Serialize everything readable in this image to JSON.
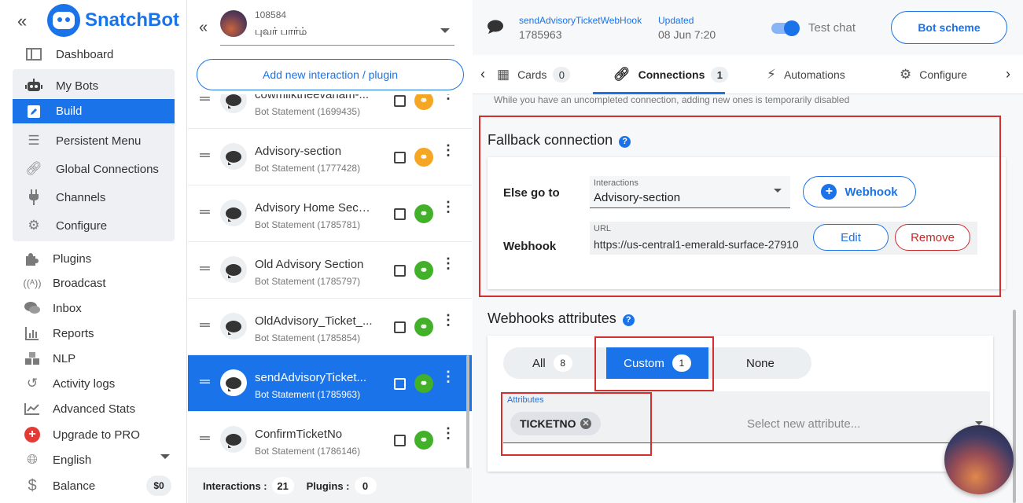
{
  "brand": {
    "name": "SnatchBot",
    "color": "#1a73e8"
  },
  "sidebar": {
    "items": [
      {
        "label": "Dashboard",
        "icon": "dashboard-icon"
      },
      {
        "label": "My Bots",
        "icon": "robot-icon"
      },
      {
        "label": "Build",
        "icon": "pencil-icon",
        "active": true
      },
      {
        "label": "Persistent Menu",
        "icon": "menu-icon"
      },
      {
        "label": "Global Connections",
        "icon": "link-icon"
      },
      {
        "label": "Channels",
        "icon": "plug-icon"
      },
      {
        "label": "Configure",
        "icon": "gear-icon"
      },
      {
        "label": "Plugins",
        "icon": "puzzle-icon"
      },
      {
        "label": "Broadcast",
        "icon": "broadcast-icon"
      },
      {
        "label": "Inbox",
        "icon": "chat-icon"
      },
      {
        "label": "Reports",
        "icon": "bar-chart-icon"
      },
      {
        "label": "NLP",
        "icon": "cubes-icon"
      },
      {
        "label": "Activity logs",
        "icon": "history-icon"
      },
      {
        "label": "Advanced Stats",
        "icon": "line-chart-icon"
      },
      {
        "label": "Upgrade to PRO",
        "icon": "plus-circle-icon"
      },
      {
        "label": "English",
        "icon": "globe-icon"
      },
      {
        "label": "Balance",
        "icon": "dollar-icon"
      }
    ],
    "balance_value": "$0"
  },
  "bot": {
    "id": "108584",
    "name": "புவர் பார்ம்"
  },
  "middle": {
    "add_button": "Add new interaction / plugin",
    "interactions": [
      {
        "title": "cowmilktheevanam-...",
        "sub": "Bot Statement (1699435)",
        "link_color": "#f5a623"
      },
      {
        "title": "Advisory-section",
        "sub": "Bot Statement (1777428)",
        "link_color": "#f5a623"
      },
      {
        "title": "Advisory Home Secti...",
        "sub": "Bot Statement (1785781)",
        "link_color": "#43b02a"
      },
      {
        "title": "Old Advisory Section",
        "sub": "Bot Statement (1785797)",
        "link_color": "#43b02a"
      },
      {
        "title": "OldAdvisory_Ticket_...",
        "sub": "Bot Statement (1785854)",
        "link_color": "#43b02a"
      },
      {
        "title": "sendAdvisoryTicket...",
        "sub": "Bot Statement (1785963)",
        "link_color": "#43b02a",
        "selected": true
      },
      {
        "title": "ConfirmTicketNo",
        "sub": "Bot Statement (1786146)",
        "link_color": "#43b02a"
      }
    ],
    "footer": {
      "interactions_label": "Interactions :",
      "interactions_count": "21",
      "plugins_label": "Plugins :",
      "plugins_count": "0"
    }
  },
  "header": {
    "interaction_name": "sendAdvisoryTicketWebHook",
    "interaction_id": "1785963",
    "updated_label": "Updated",
    "updated_date": "08 Jun 7:20",
    "test_chat_label": "Test chat",
    "test_chat_on": true,
    "bot_scheme_button": "Bot scheme"
  },
  "tabs": [
    {
      "label": "Cards",
      "count": "0",
      "icon": "cards-icon"
    },
    {
      "label": "Connections",
      "count": "1",
      "icon": "link-icon",
      "active": true
    },
    {
      "label": "Automations",
      "icon": "bolt-icon"
    },
    {
      "label": "Configure",
      "icon": "gear-icon"
    }
  ],
  "connections": {
    "notice": "While you have an uncompleted connection, adding new ones is temporarily disabled",
    "fallback_title": "Fallback connection",
    "else_go_to_label": "Else go to",
    "interactions_field_label": "Interactions",
    "interactions_field_value": "Advisory-section",
    "webhook_button": "Webhook",
    "webhook_label": "Webhook",
    "url_label": "URL",
    "url_value": "https://us-central1-emerald-surface-27910",
    "edit_button": "Edit",
    "remove_button": "Remove"
  },
  "webhook_attributes": {
    "title": "Webhooks attributes",
    "options": [
      {
        "label": "All",
        "count": "8"
      },
      {
        "label": "Custom",
        "count": "1",
        "active": true
      },
      {
        "label": "None"
      }
    ],
    "field_label": "Attributes",
    "chips": [
      "TICKETNO"
    ],
    "placeholder": "Select new attribute..."
  },
  "colors": {
    "highlight_box": "#d32f2f",
    "remove": "#c62828"
  }
}
